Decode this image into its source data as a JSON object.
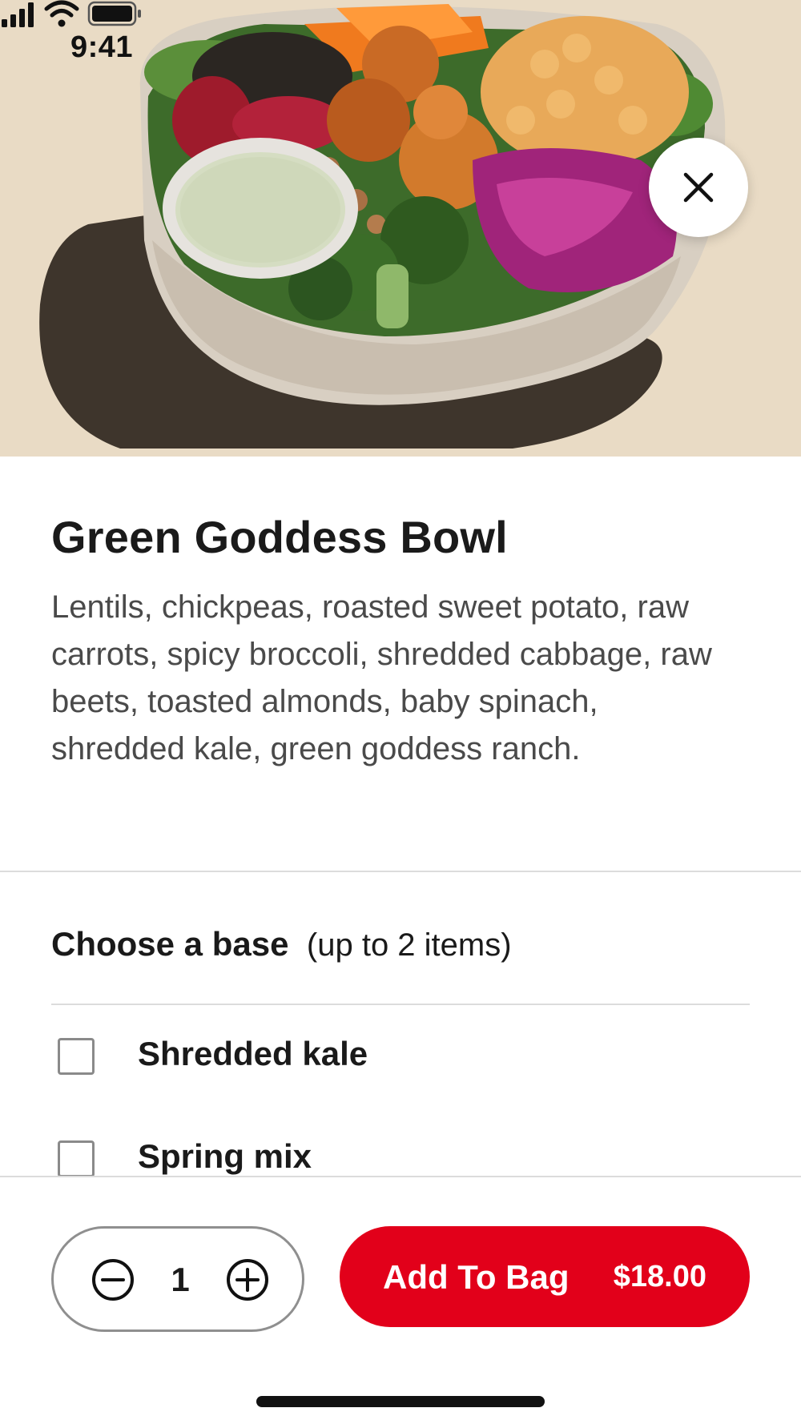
{
  "status_bar": {
    "time": "9:41",
    "icons": [
      "cellular-signal-icon",
      "wifi-icon",
      "battery-icon"
    ]
  },
  "hero": {
    "image": "salad-bowl-photo",
    "close_icon": "close-icon"
  },
  "product": {
    "title": "Green Goddess Bowl",
    "description": "Lentils, chickpeas, roasted sweet potato, raw carrots, spicy broccoli, shredded cabbage, raw beets, toasted almonds, baby spinach, shredded kale, green goddess ranch."
  },
  "base_section": {
    "title": "Choose a base",
    "note": "(up to 2 items)",
    "options": [
      {
        "label": "Shredded kale",
        "checked": false
      },
      {
        "label": "Spring mix",
        "checked": false
      }
    ]
  },
  "cart": {
    "quantity": "1",
    "minus_icon": "minus-circle-icon",
    "plus_icon": "plus-circle-icon",
    "add_label": "Add To Bag",
    "price": "$18.00"
  },
  "colors": {
    "accent": "#e2001a",
    "hero_background": "#e9dbc5",
    "text": "#1a1a1a",
    "muted_text": "#4a4a4a",
    "divider": "#dcdcdc"
  }
}
